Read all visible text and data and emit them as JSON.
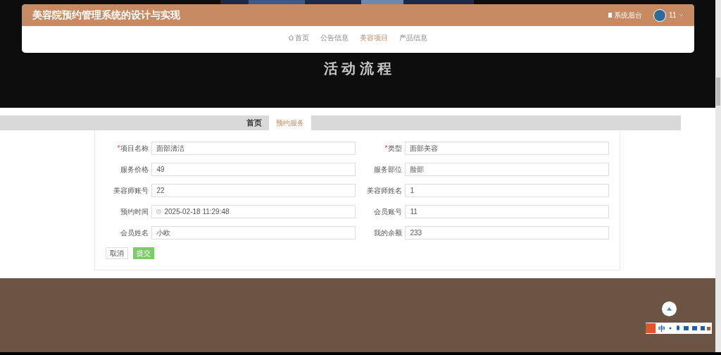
{
  "header": {
    "title": "美容院预约管理系统的设计与实现",
    "admin_link": "系统后台",
    "user": "11"
  },
  "nav": [
    {
      "label": "首页",
      "kind": "home",
      "selected": false
    },
    {
      "label": "公告信息",
      "selected": false
    },
    {
      "label": "美容项目",
      "selected": true
    },
    {
      "label": "产品信息",
      "selected": false
    }
  ],
  "banner": {
    "title": "活 动 流 程"
  },
  "tabs": [
    {
      "label": "首页",
      "selected": false
    },
    {
      "label": "预约服务",
      "selected": true
    }
  ],
  "form": {
    "fields": [
      {
        "label": "项目名称",
        "required_mark": "*",
        "value": "面部清洁"
      },
      {
        "label": "类型",
        "required_mark": "*",
        "value": "面部美容"
      },
      {
        "label": "服务价格",
        "value": "49"
      },
      {
        "label": "服务部位",
        "value": "脸部"
      },
      {
        "label": "美容师账号",
        "value": "22"
      },
      {
        "label": "美容师姓名",
        "value": "1"
      },
      {
        "label": "预约时间",
        "value": "2025-02-18 11:29:48",
        "kind": "datetime"
      },
      {
        "label": "会员账号",
        "value": "11"
      },
      {
        "label": "会员姓名",
        "value": "小欧"
      },
      {
        "label": "我的余额",
        "value": "233"
      }
    ],
    "buttons": [
      {
        "label": "取消",
        "kind": "default"
      },
      {
        "label": "提交",
        "kind": "primary"
      }
    ]
  },
  "ime": {
    "label": "中"
  }
}
